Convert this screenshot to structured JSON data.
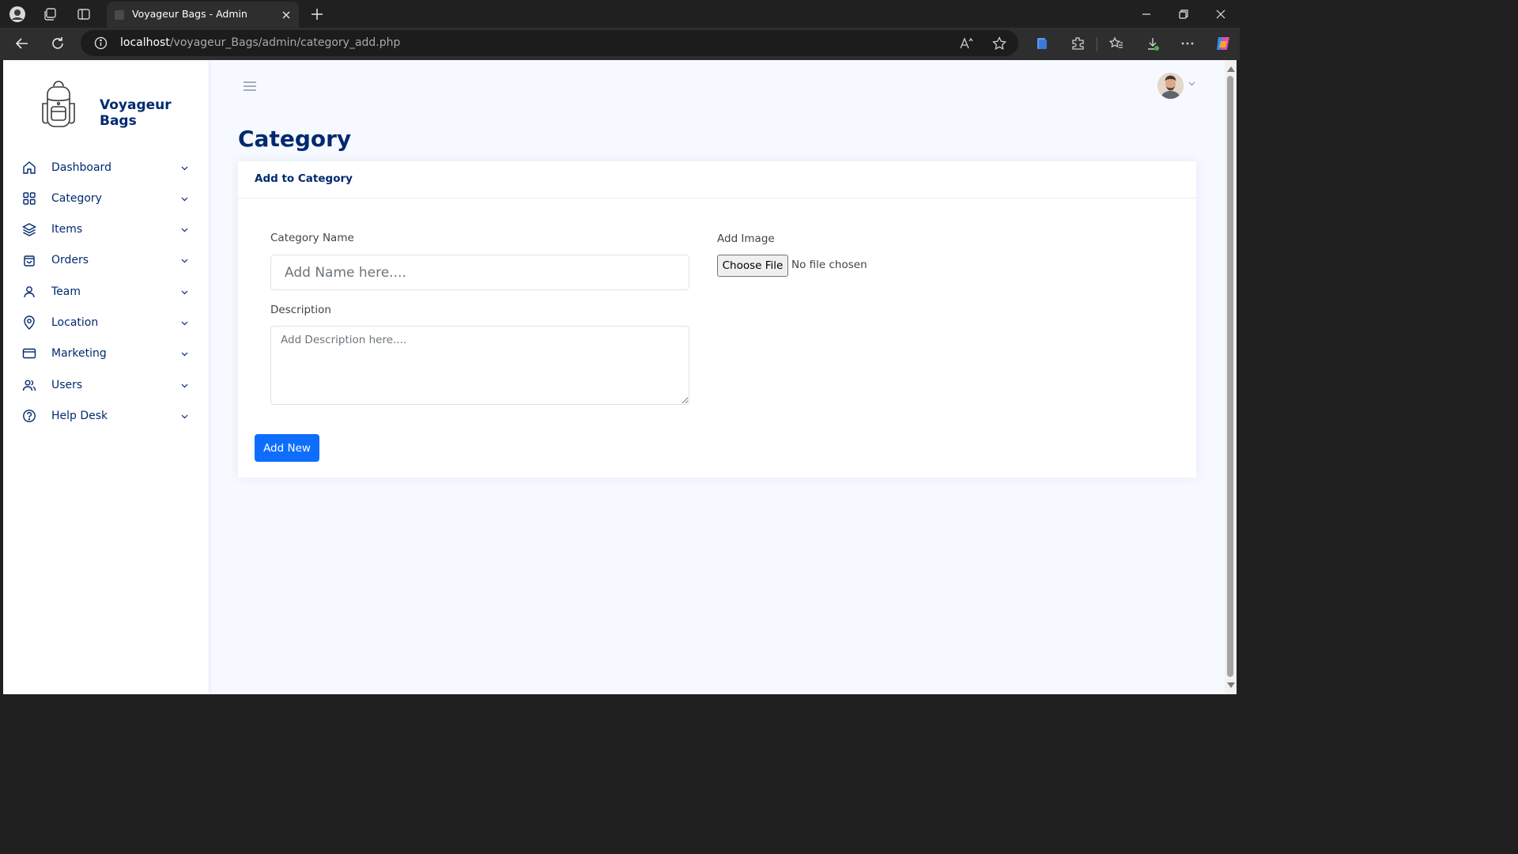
{
  "browser": {
    "tab_title": "Voyageur Bags - Admin",
    "url_host": "localhost",
    "url_path": "/voyageur_Bags/admin/category_add.php"
  },
  "sidebar": {
    "brand": "Voyageur Bags",
    "items": [
      {
        "label": "Dashboard",
        "icon": "house-icon"
      },
      {
        "label": "Category",
        "icon": "grid-icon"
      },
      {
        "label": "Items",
        "icon": "layers-icon"
      },
      {
        "label": "Orders",
        "icon": "bag-icon"
      },
      {
        "label": "Team",
        "icon": "person-icon"
      },
      {
        "label": "Location",
        "icon": "map-pin-icon"
      },
      {
        "label": "Marketing",
        "icon": "credit-card-icon"
      },
      {
        "label": "Users",
        "icon": "people-icon"
      },
      {
        "label": "Help Desk",
        "icon": "question-circle-icon"
      }
    ]
  },
  "main": {
    "page_title": "Category",
    "card": {
      "title": "Add to Category",
      "name_label": "Category Name",
      "name_placeholder": "Add Name here....",
      "description_label": "Description",
      "description_placeholder": "Add Description here....",
      "image_label": "Add Image",
      "file_button": "Choose File",
      "file_status": "No file chosen",
      "submit": "Add New"
    }
  },
  "colors": {
    "brand_navy": "#012970",
    "primary": "#0d6efd",
    "page_bg": "#f6f9ff"
  }
}
